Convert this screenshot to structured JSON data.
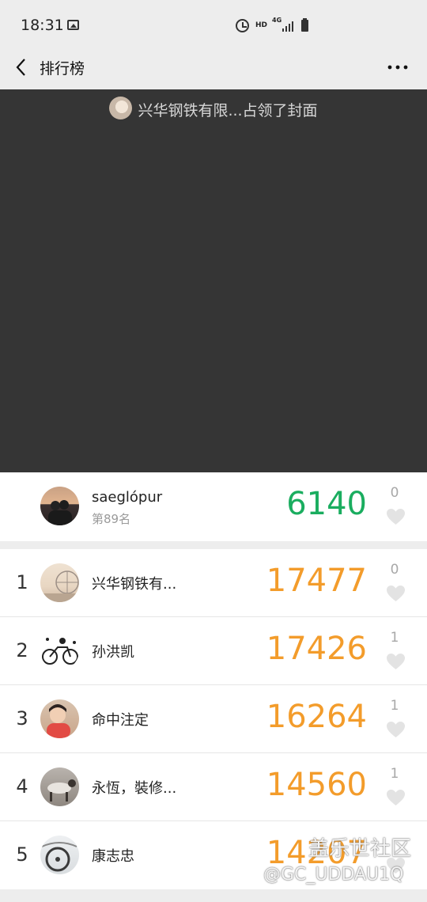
{
  "status_bar": {
    "time": "18:31",
    "hd": "HD",
    "network": "4G",
    "icons": [
      "gallery-icon",
      "alarm-icon",
      "signal-icon",
      "battery-icon"
    ]
  },
  "nav": {
    "title": "排行榜",
    "back_icon": "back-icon",
    "more_icon": "more-icon"
  },
  "cover": {
    "caption": "兴华钢铁有限...占领了封面"
  },
  "my_entry": {
    "name": "saeglópur",
    "rank_text": "第89名",
    "steps": "6140",
    "likes": "0"
  },
  "ranking": [
    {
      "rank": "1",
      "name": "兴华钢铁有...",
      "steps": "17477",
      "likes": "0"
    },
    {
      "rank": "2",
      "name": "孙洪凯",
      "steps": "17426",
      "likes": "1"
    },
    {
      "rank": "3",
      "name": "命中注定",
      "steps": "16264",
      "likes": "1"
    },
    {
      "rank": "4",
      "name": "永恆，裝修...",
      "steps": "14560",
      "likes": "1"
    },
    {
      "rank": "5",
      "name": "康志忠",
      "steps": "14207",
      "likes": ""
    }
  ],
  "watermark": {
    "main": "盖乐世社区",
    "sub": "@GC_UDDAU1Q"
  },
  "colors": {
    "steps_other": "#f39c2b",
    "steps_mine": "#1aad5f",
    "cover_bg": "#353535",
    "page_bg": "#ededed"
  }
}
